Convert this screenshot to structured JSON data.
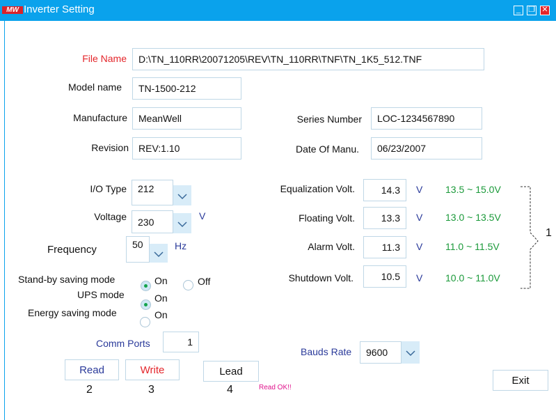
{
  "window": {
    "title": "Inverter Setting",
    "logo_text": "MW"
  },
  "file": {
    "label": "File Name",
    "value": "D:\\TN_110RR\\20071205\\REV\\TN_110RR\\TNF\\TN_1K5_512.TNF"
  },
  "model": {
    "label": "Model name",
    "value": "TN-1500-212"
  },
  "manufacture": {
    "label": "Manufacture",
    "value": "MeanWell"
  },
  "revision": {
    "label": "Revision",
    "value": "REV:1.10"
  },
  "series": {
    "label": "Series Number",
    "value": "LOC-1234567890"
  },
  "date": {
    "label": "Date Of Manu.",
    "value": "06/23/2007"
  },
  "io_type": {
    "label": "I/O Type",
    "value": "212"
  },
  "voltage": {
    "label": "Voltage",
    "value": "230",
    "unit": "V"
  },
  "frequency": {
    "label": "Frequency",
    "value": "50",
    "unit": "Hz"
  },
  "volts": [
    {
      "label": "Equalization Volt.",
      "value": "14.3",
      "unit": "V",
      "range": "13.5 ~ 15.0V"
    },
    {
      "label": "Floating Volt.",
      "value": "13.3",
      "unit": "V",
      "range": "13.0 ~ 13.5V"
    },
    {
      "label": "Alarm Volt.",
      "value": "11.3",
      "unit": "V",
      "range": "11.0 ~ 11.5V"
    },
    {
      "label": "Shutdown Volt.",
      "value": "10.5",
      "unit": "V",
      "range": "10.0 ~ 11.0V"
    }
  ],
  "bracket_label": "1",
  "modes": {
    "standby": {
      "label": "Stand-by saving mode",
      "on": "On",
      "off": "Off"
    },
    "ups": {
      "label": "UPS mode",
      "on": "On"
    },
    "energy": {
      "label": "Energy saving mode",
      "on": "On"
    }
  },
  "comm": {
    "label": "Comm Ports",
    "value": "1"
  },
  "baud": {
    "label": "Bauds Rate",
    "value": "9600"
  },
  "buttons": {
    "read": "Read",
    "write": "Write",
    "lead": "Lead",
    "exit": "Exit"
  },
  "button_numbers": {
    "read": "2",
    "write": "3",
    "lead": "4"
  },
  "status": "Read OK!!",
  "colors": {
    "titlebar": "#0aa2ec",
    "label_blue": "#2a3a9a",
    "label_red": "#e4262b",
    "range_green": "#1b9a3a",
    "status_magenta": "#e0148c"
  }
}
